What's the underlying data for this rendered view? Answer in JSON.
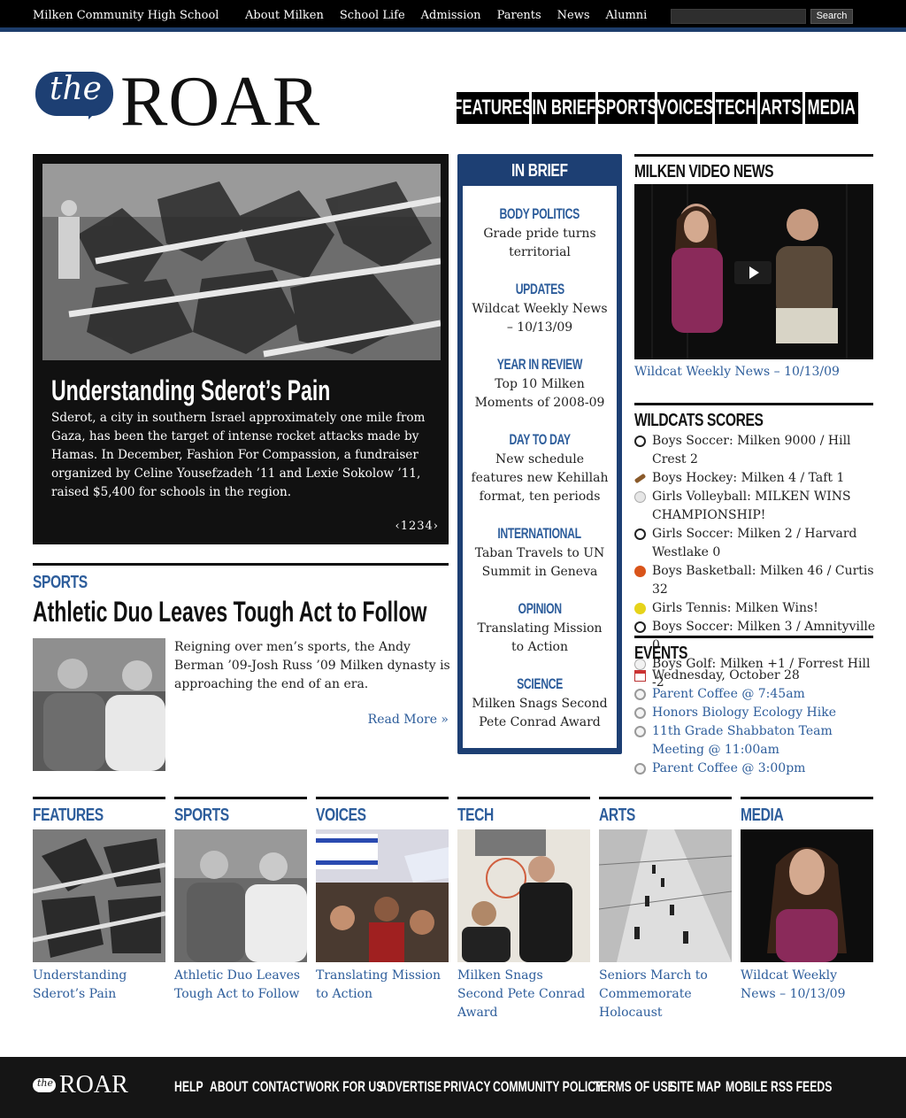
{
  "topbar": {
    "school": "Milken Community High School",
    "nav": [
      "About Milken",
      "School Life",
      "Admission",
      "Parents",
      "News",
      "Alumni"
    ],
    "search_placeholder": "",
    "search_label": "Search"
  },
  "logo": {
    "the": "the",
    "roar": "ROAR"
  },
  "mainnav": [
    "FEATURES",
    "IN BRIEF",
    "SPORTS",
    "VOICES",
    "TECH",
    "ARTS",
    "MEDIA"
  ],
  "featured": {
    "title": "Understanding Sderot’s Pain",
    "body": "Sderot, a city in southern Israel approximately one mile from Gaza, has been the target of intense rocket attacks made by Hamas. In December, Fashion For Compassion, a fundraiser organized by Celine Yousefzadeh ’11 and Lexie Sokolow ’11, raised $5,400 for schools in the region.",
    "pager": "‹1234›"
  },
  "sports_story": {
    "kicker": "SPORTS",
    "title": "Athletic Duo Leaves Tough Act to Follow",
    "excerpt": "Reigning over men’s sports, the Andy Berman ’09-Josh Russ ’09 Milken dynasty is approaching the end of an era.",
    "more": "Read More »"
  },
  "inbrief": {
    "heading": "IN BRIEF",
    "items": [
      {
        "cat": "BODY POLITICS",
        "text": "Grade pride turns territorial"
      },
      {
        "cat": "UPDATES",
        "text": "Wildcat Weekly News – 10/13/09"
      },
      {
        "cat": "YEAR IN REVIEW",
        "text": "Top 10 Milken Moments of 2008-09"
      },
      {
        "cat": "DAY TO DAY",
        "text": "New schedule features new Kehillah format, ten periods"
      },
      {
        "cat": "INTERNATIONAL",
        "text": "Taban Travels to UN Summit in Geneva"
      },
      {
        "cat": "OPINION",
        "text": "Translating Mission to Action"
      },
      {
        "cat": "SCIENCE",
        "text": "Milken Snags Second Pete Conrad Award"
      }
    ]
  },
  "video": {
    "heading": "MILKEN VIDEO NEWS",
    "caption": "Wildcat Weekly News – 10/13/09"
  },
  "scores": {
    "heading": "WILDCATS SCORES",
    "items": [
      {
        "icon": "soccer-ball-icon",
        "text": "Boys Soccer: Milken 9000 / Hill Crest 2"
      },
      {
        "icon": "hockey-stick-icon",
        "text": "Boys Hockey: Milken 4 / Taft 1"
      },
      {
        "icon": "volleyball-icon",
        "text": "Girls Volleyball: MILKEN WINS CHAMPIONSHIP!"
      },
      {
        "icon": "soccer-ball-icon",
        "text": "Girls Soccer: Milken 2 / Harvard Westlake 0"
      },
      {
        "icon": "basketball-icon",
        "text": "Boys Basketball: Milken 46 / Curtis 32"
      },
      {
        "icon": "tennis-ball-icon",
        "text": "Girls Tennis: Milken Wins!"
      },
      {
        "icon": "soccer-ball-icon",
        "text": "Boys Soccer: Milken 3 / Amnityville 0"
      },
      {
        "icon": "golf-ball-icon",
        "text": "Boys Golf: Milken +1 / Forrest Hill -2"
      }
    ]
  },
  "events": {
    "heading": "EVENTS",
    "date": "Wednesday, October 28",
    "items": [
      "Parent Coffee @ 7:45am",
      "Honors Biology Ecology Hike",
      "11th Grade Shabbaton Team Meeting @ 11:00am",
      "Parent Coffee @ 3:00pm"
    ]
  },
  "sections": [
    {
      "head": "FEATURES",
      "caption": "Understanding Sderot’s Pain"
    },
    {
      "head": "SPORTS",
      "caption": "Athletic Duo Leaves Tough Act to Follow"
    },
    {
      "head": "VOICES",
      "caption": "Translating Mission to Action"
    },
    {
      "head": "TECH",
      "caption": "Milken Snags Second Pete Conrad Award"
    },
    {
      "head": "ARTS",
      "caption": "Seniors March to Commemorate Holocaust"
    },
    {
      "head": "MEDIA",
      "caption": "Wildcat Weekly News – 10/13/09"
    }
  ],
  "footer": {
    "logo_the": "the",
    "logo_roar": "ROAR",
    "nav": [
      "HELP",
      "ABOUT",
      "CONTACT",
      "WORK FOR US",
      "ADVERTISE",
      "PRIVACY",
      "COMMUNITY POLICY",
      "TERMS OF USE",
      "SITE MAP",
      "MOBILE",
      "RSS FEEDS"
    ]
  },
  "colors": {
    "brand_blue": "#1d3f73",
    "link_blue": "#2d5d9b",
    "black": "#000000"
  }
}
